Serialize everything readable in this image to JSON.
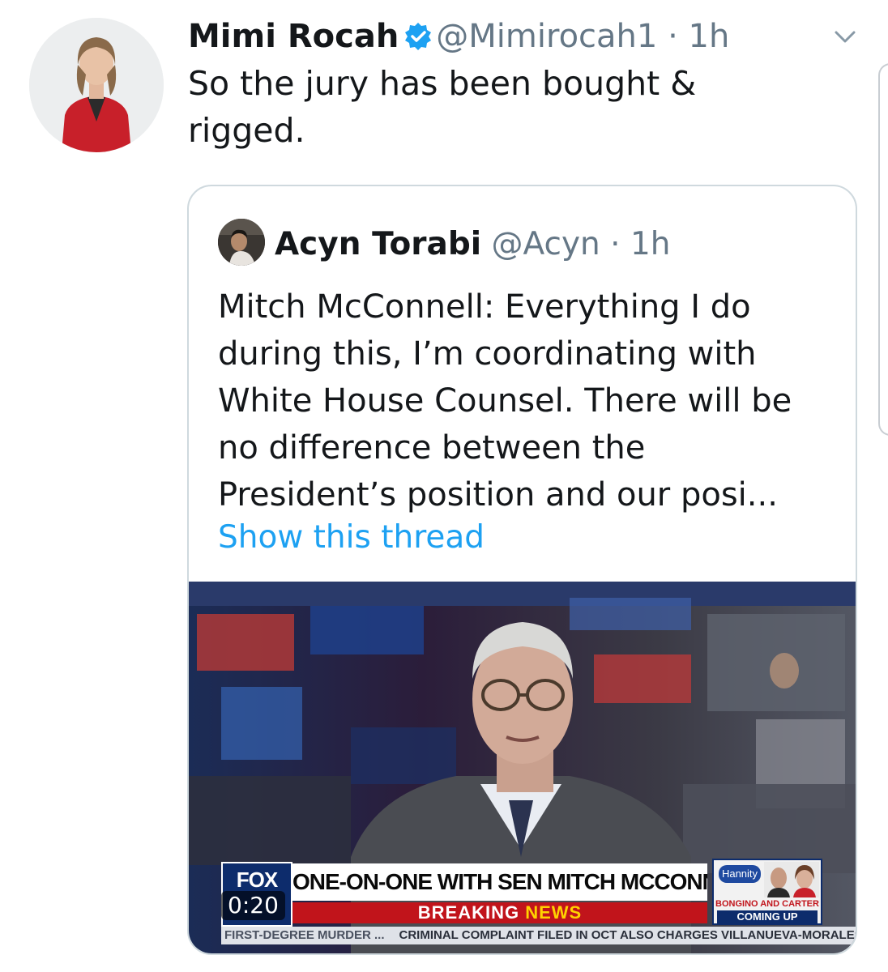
{
  "tweet": {
    "author_name": "Mimi Rocah",
    "verified": true,
    "handle": "@Mimirocah1",
    "separator": "·",
    "time": "1h",
    "text": "So the jury has been bought & rigged."
  },
  "quoted_tweet": {
    "author_name": "Acyn Torabi",
    "handle": "@Acyn",
    "separator": "·",
    "time": "1h",
    "text": "Mitch McConnell: Everything I do during this, I’m coordinating with White House Counsel. There will be no difference between the President’s position and our posi...",
    "show_thread": "Show this thread",
    "media": {
      "type": "video",
      "duration": "0:20",
      "broadcast": {
        "network_logo": "FOX",
        "headline": "ONE-ON-ONE WITH SEN MITCH MCCONNELL",
        "banner_left": "BREAKING ",
        "banner_right": "NEWS",
        "promo_show": "Hannity",
        "promo_guests": "BONGINO AND CARTER",
        "promo_status": "COMING UP",
        "ticker_1": "FIRST-DEGREE MURDER ...",
        "ticker_2": "CRIMINAL COMPLAINT FILED IN OCT ALSO CHARGES VILLANUEVA-MORALES W"
      }
    }
  },
  "colors": {
    "link": "#1da1f2",
    "secondary_text": "#657786",
    "verified": "#1da1f2",
    "fox_blue": "#0d2c6c",
    "breaking_red": "#c1141b"
  }
}
